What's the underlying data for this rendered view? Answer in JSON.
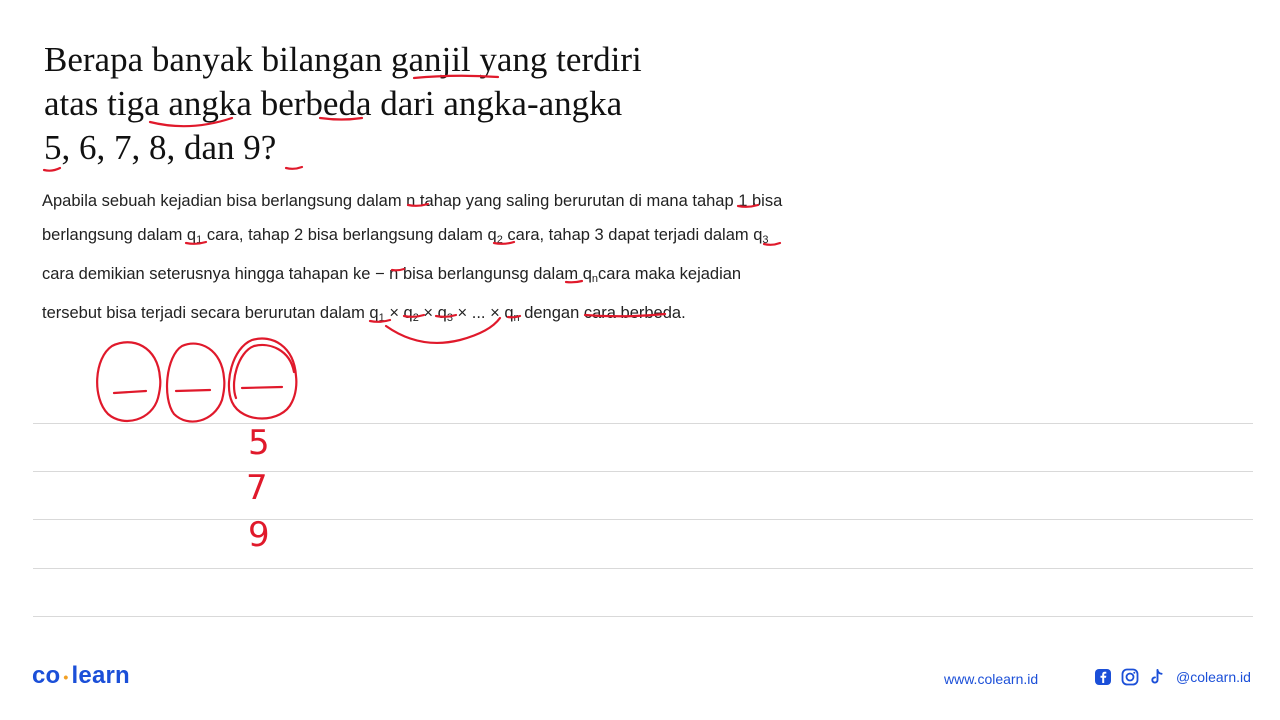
{
  "question": {
    "line1": "Berapa banyak bilangan ganjil yang terdiri",
    "line2": "atas tiga angka berbeda dari angka-angka",
    "line3": "5, 6, 7, 8, dan 9?"
  },
  "rule": {
    "l1": "Apabila sebuah kejadian bisa berlangsung dalam n tahap yang saling berurutan di mana tahap 1 bisa",
    "l2a": "berlangsung dalam q",
    "l2s1": "1",
    "l2b": " cara, tahap 2 bisa berlangsung dalam q",
    "l2s2": "2",
    "l2c": " cara, tahap 3 dapat terjadi dalam q",
    "l2s3": "3",
    "l3a": "cara demikian seterusnya hingga tahapan ke − n bisa berlangunsg dalam q",
    "l3s": "n",
    "l3b": "cara maka kejadian",
    "l4a": "tersebut bisa terjadi secara berurutan dalam q",
    "l4s1": "1",
    "l4b": " × q",
    "l4s2": "2",
    "l4c": " × q",
    "l4s3": "3",
    "l4d": " × ... × q",
    "l4s4": "n",
    "l4e": " dengan cara berbeda."
  },
  "handwriting": {
    "digits": [
      "5",
      "7",
      "9"
    ]
  },
  "footer": {
    "logo_left": "co",
    "logo_dot": "•",
    "logo_right": "learn",
    "url": "www.colearn.id",
    "handle": "@colearn.id"
  },
  "colors": {
    "brand_blue": "#1b4fd8",
    "brand_orange": "#f2a024",
    "ink_red": "#e0192b"
  },
  "icons": [
    "facebook-icon",
    "instagram-icon",
    "tiktok-icon"
  ]
}
